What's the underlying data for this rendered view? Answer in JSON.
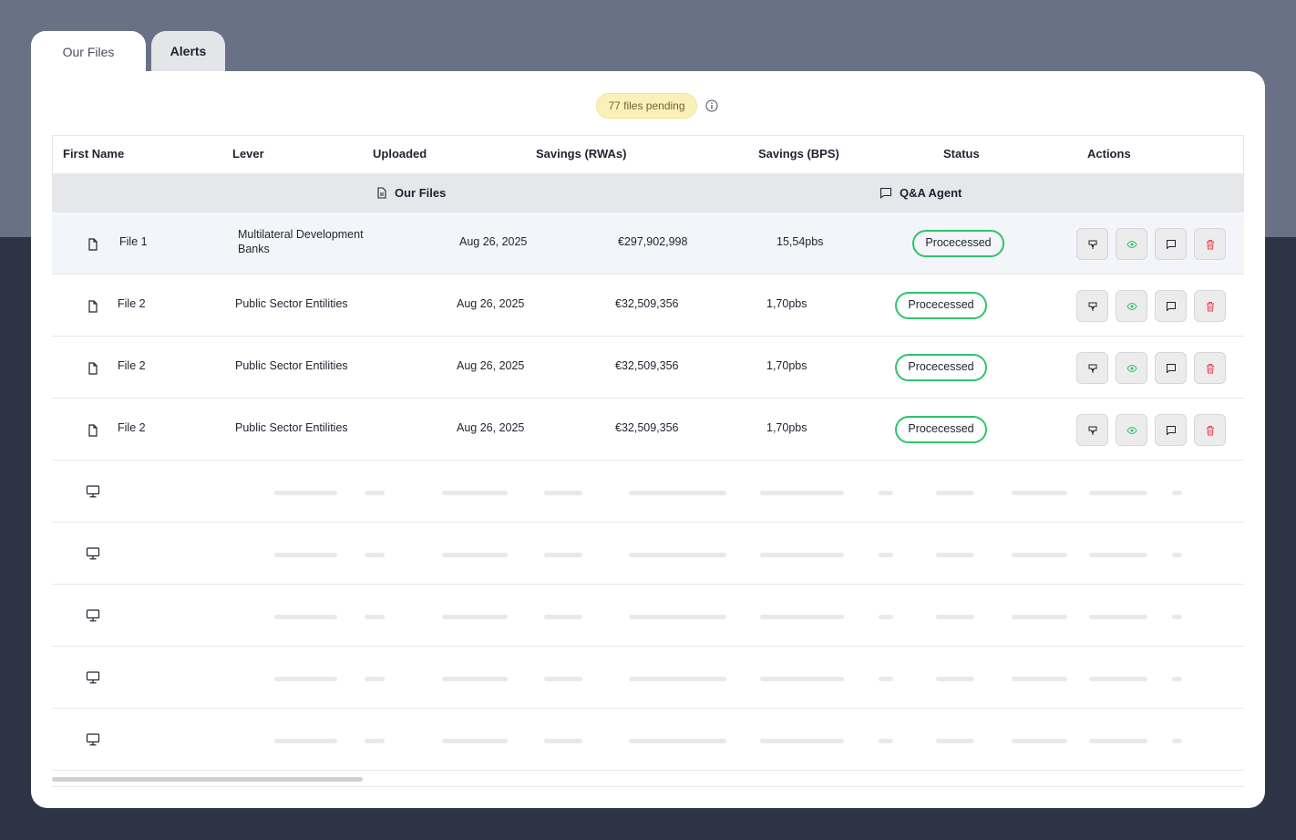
{
  "tabs": [
    {
      "label": "Our Files",
      "active": true
    },
    {
      "label": "Alerts",
      "active": false
    }
  ],
  "pending": {
    "label": "77 files pending"
  },
  "table": {
    "headers": [
      "First Name",
      "Lever",
      "Uploaded",
      "Savings (RWAs)",
      "Savings (BPS)",
      "Status",
      "Actions"
    ],
    "groups": [
      {
        "label": "Our Files",
        "icon": "document-icon"
      },
      {
        "label": "Q&A Agent",
        "icon": "chat-icon"
      }
    ],
    "rows": [
      {
        "name": "File 1",
        "lever": "Multilateral Development Banks",
        "uploaded": "Aug 26, 2025",
        "rwas": "€297,902,998",
        "bps": "15,54pbs",
        "status": "Procecessed"
      },
      {
        "name": "File 2",
        "lever": "Public Sector Entilities",
        "uploaded": "Aug 26, 2025",
        "rwas": "€32,509,356",
        "bps": "1,70pbs",
        "status": "Procecessed"
      },
      {
        "name": "File 2",
        "lever": "Public Sector Entilities",
        "uploaded": "Aug 26, 2025",
        "rwas": "€32,509,356",
        "bps": "1,70pbs",
        "status": "Procecessed"
      },
      {
        "name": "File 2",
        "lever": "Public Sector Entilities",
        "uploaded": "Aug 26, 2025",
        "rwas": "€32,509,356",
        "bps": "1,70pbs",
        "status": "Procecessed"
      }
    ],
    "actions": [
      "download-icon",
      "eye-icon",
      "chat-icon",
      "trash-icon"
    ],
    "skeleton_rows": 5
  },
  "colors": {
    "status_border": "#2dc46a",
    "eye_icon": "#2dc46a",
    "trash_icon": "#e5484d",
    "pending_bg": "#fbf1b8"
  }
}
